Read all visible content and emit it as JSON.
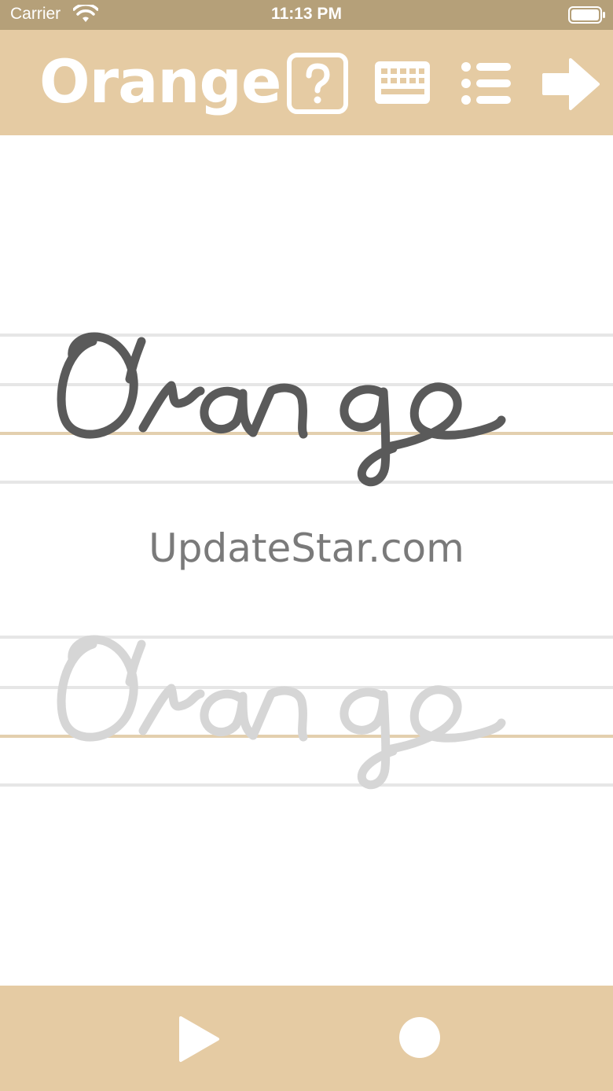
{
  "status_bar": {
    "carrier": "Carrier",
    "time": "11:13 PM",
    "wifi_icon": "wifi-icon",
    "battery_icon": "battery-icon"
  },
  "header": {
    "word": "Orange",
    "help_icon": "question-mark-icon",
    "keyboard_icon": "keyboard-icon",
    "list_icon": "list-icon",
    "next_icon": "arrow-right-icon"
  },
  "practice": {
    "model_word": "Orange",
    "trace_word": "Orange",
    "watermark": "UpdateStar.com"
  },
  "bottom_bar": {
    "play_icon": "play-icon",
    "record_icon": "record-dot-icon"
  },
  "colors": {
    "status_bar": "#b5a079",
    "bar_background": "#e5cba3",
    "guide_line": "#e6e6e6",
    "base_line": "#e3cfae",
    "model_stroke": "#5a5a5a",
    "trace_stroke": "#d6d6d6",
    "icon": "#ffffff"
  }
}
